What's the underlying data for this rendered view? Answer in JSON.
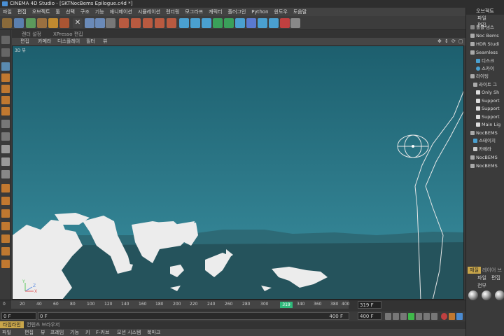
{
  "window": {
    "title": "CINEMA 4D Studio - [SKTNocBems Epilogue.c4d *]"
  },
  "menubar": [
    "파일",
    "편집",
    "오브젝트",
    "툴",
    "선택",
    "구조",
    "기능",
    "애니메이션",
    "시뮬레이션",
    "렌더링",
    "모그라프",
    "캐릭터",
    "플러그인",
    "Python",
    "윈도우",
    "도움말"
  ],
  "viewport": {
    "tabs": [
      "렌더 설정",
      "XPresso 편집"
    ],
    "menu": [
      "편집",
      "카메라",
      "디스플레이",
      "필터",
      "뷰"
    ],
    "label": "3D 뷰",
    "axis_labels": {
      "y": "Y",
      "z": "Z",
      "x": "X"
    },
    "colors": {
      "sky_top": "#1d5f6e",
      "sky_bottom": "#3a8fa0",
      "ground": "#25535c",
      "land": "#ececec",
      "wire": "#e8e8e8"
    }
  },
  "object_manager": {
    "title": "오브젝트",
    "menu": [
      "파일",
      "편집"
    ],
    "items": [
      {
        "label": "플롤 넘스"
      },
      {
        "label": "Noc Bems"
      },
      {
        "label": "HDR Studi"
      },
      {
        "label": "Seamless"
      },
      {
        "label": "디스크"
      },
      {
        "label": "스카이"
      },
      {
        "label": "라이팅"
      },
      {
        "label": "라이트 그"
      },
      {
        "label": "Only Sh"
      },
      {
        "label": "Support"
      },
      {
        "label": "Support"
      },
      {
        "label": "Support"
      },
      {
        "label": "Main Lig"
      },
      {
        "label": "NocBEMS"
      },
      {
        "label": "스테이지"
      },
      {
        "label": "카메라"
      },
      {
        "label": "NocBEMS"
      },
      {
        "label": "NocBEMS"
      }
    ]
  },
  "material_manager": {
    "tabs": [
      "재질",
      "레이어 브"
    ],
    "menu": [
      "파일",
      "편집"
    ],
    "sub": "전부"
  },
  "timeline": {
    "ticks": [
      "0",
      "20",
      "40",
      "60",
      "80",
      "100",
      "120",
      "140",
      "160",
      "180",
      "200",
      "220",
      "240",
      "260",
      "280",
      "300",
      "319",
      "340",
      "360",
      "380",
      "400"
    ],
    "current_frame": "319",
    "frame_display": "319 F"
  },
  "transport": {
    "start_field": "0 F",
    "min_field": "0 F",
    "end_field": "400 F",
    "max_field": "400 F"
  },
  "bottom": {
    "tabs": [
      "타임라인",
      "컨텐츠 브라우저"
    ],
    "menu": [
      "파일",
      "편집",
      "뷰",
      "프레임",
      "기능",
      "키",
      "F-커브",
      "모션 시스템",
      "북마크"
    ]
  }
}
